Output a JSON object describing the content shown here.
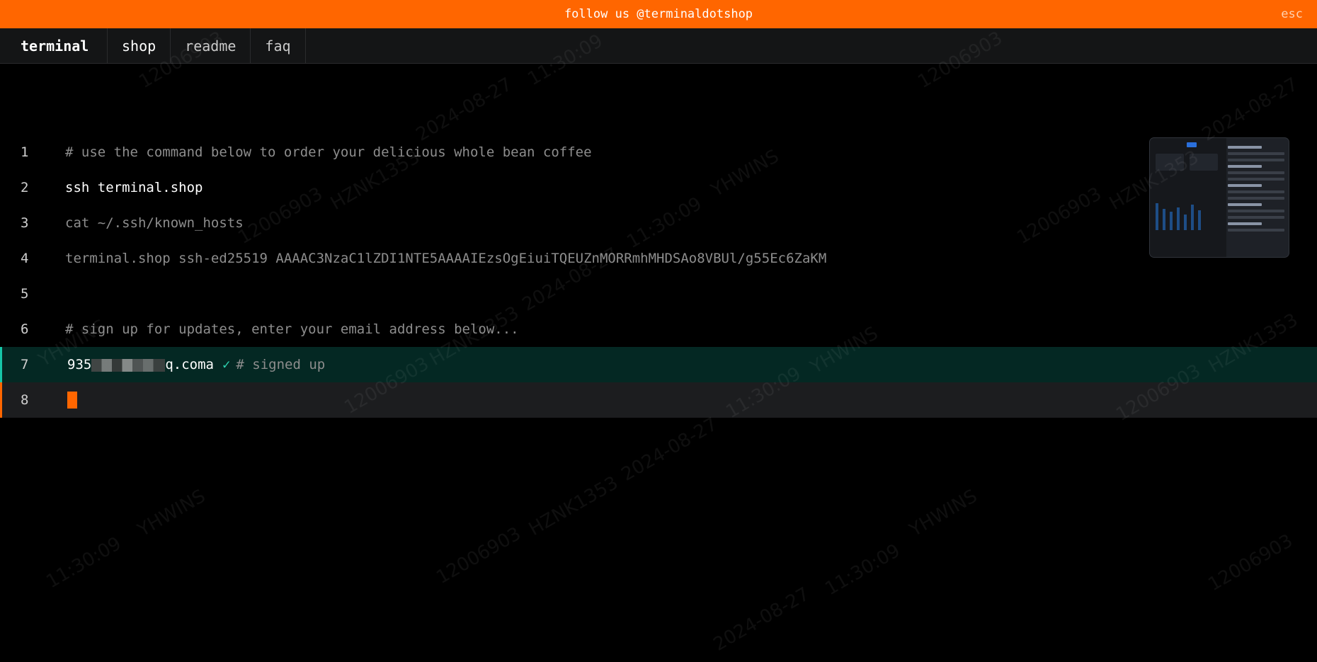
{
  "banner": {
    "text": "follow us @terminaldotshop",
    "esc_label": "esc"
  },
  "nav": {
    "brand": "terminal",
    "tabs": [
      {
        "label": "shop",
        "active": true
      },
      {
        "label": "readme",
        "active": false
      },
      {
        "label": "faq",
        "active": false
      }
    ]
  },
  "editor": {
    "lines": [
      {
        "num": "1",
        "text": "# use the command below to order your delicious whole bean coffee"
      },
      {
        "num": "2",
        "text": "ssh terminal.shop"
      },
      {
        "num": "3",
        "text": "cat ~/.ssh/known_hosts"
      },
      {
        "num": "4",
        "text": "terminal.shop ssh-ed25519 AAAAC3NzaC1lZDI1NTE5AAAAIEzsOgEiuiTQEUZnMORRmhMHDSAo8VBUl/g55Ec6ZaKM"
      },
      {
        "num": "5",
        "text": ""
      },
      {
        "num": "6",
        "text": "# sign up for updates, enter your email address below..."
      },
      {
        "num": "7",
        "email_start": "935",
        "email_end": "q.coma",
        "check": "✓",
        "note": "# signed up"
      },
      {
        "num": "8",
        "text": ""
      }
    ]
  },
  "watermark": {
    "lines": [
      "12006903",
      "2024-08-27",
      "11:30:09",
      "HZNK1353",
      "YHWINS"
    ]
  },
  "colors": {
    "accent": "#ff6600",
    "success": "#16c6a8",
    "background": "#000000"
  }
}
